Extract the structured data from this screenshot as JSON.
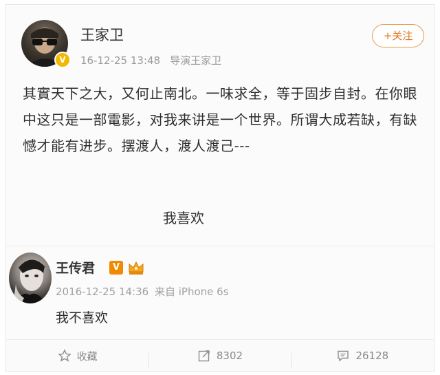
{
  "post": {
    "username": "王家卫",
    "timestamp": "16-12-25 13:48",
    "source": "导演王家卫",
    "follow_label": "+关注",
    "verified_mark": "V",
    "body": "其實天下之大，又何止南北。一味求全，等于固步自封。在你眼中这只是一部電影，对我来讲是一个世界。所谓大成若缺，有缺憾才能有进步。摆渡人，渡人渡己---",
    "tail": "我喜欢"
  },
  "comment": {
    "username": "王传君",
    "vip_mark": "V",
    "timestamp": "2016-12-25 14:36",
    "source_prefix": "来自",
    "source": "iPhone 6s",
    "text": "我不喜欢"
  },
  "actions": {
    "favorite_label": "收藏",
    "repost_count": "8302",
    "comment_count": "26128"
  },
  "colors": {
    "follow_accent": "#e2771c",
    "verified_gold": "#f3b800",
    "vip_orange": "#f08a00"
  }
}
